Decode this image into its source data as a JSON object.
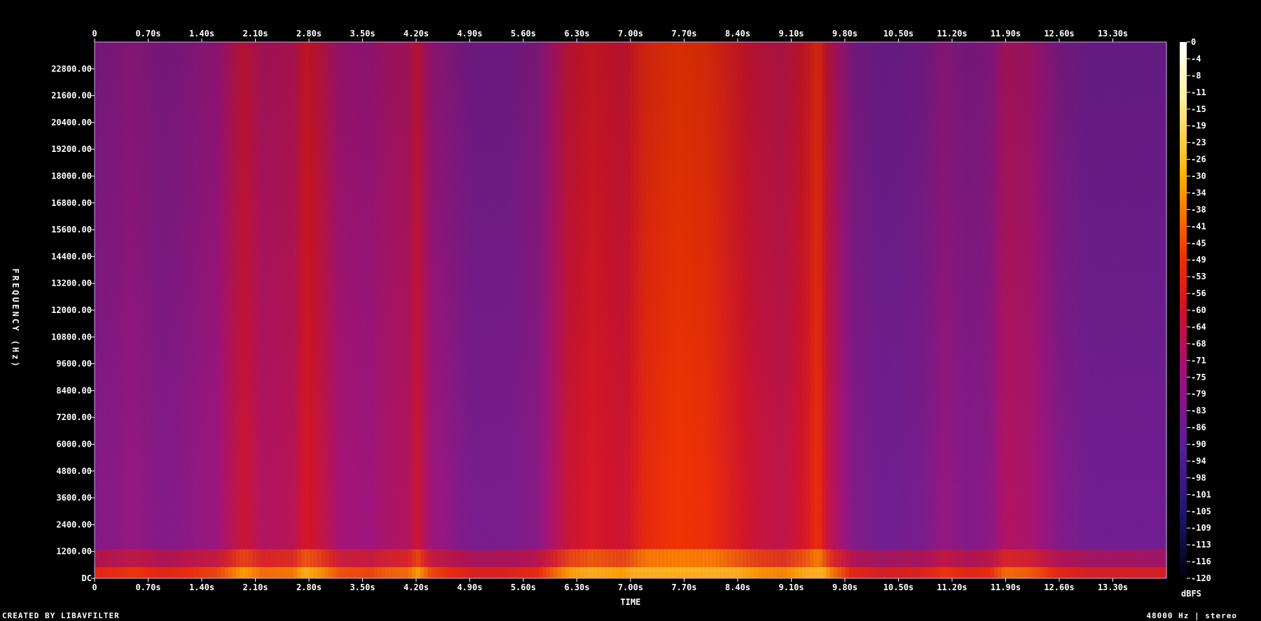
{
  "chart_data": {
    "type": "heatmap",
    "subtype": "spectrogram",
    "xlabel": "TIME",
    "ylabel": "FREQUENCY (Hz)",
    "x_ticks": [
      "0",
      "0.70s",
      "1.40s",
      "2.10s",
      "2.80s",
      "3.50s",
      "4.20s",
      "4.90s",
      "5.60s",
      "6.30s",
      "7.00s",
      "7.70s",
      "8.40s",
      "9.10s",
      "9.80s",
      "10.50s",
      "11.20s",
      "11.90s",
      "12.60s",
      "13.30s"
    ],
    "x_range_seconds": [
      0,
      14.0
    ],
    "y_ticks": [
      "DC",
      "1200.00",
      "2400.00",
      "3600.00",
      "4800.00",
      "6000.00",
      "7200.00",
      "8400.00",
      "9600.00",
      "10800.00",
      "12000.00",
      "13200.00",
      "14400.00",
      "15600.00",
      "16800.00",
      "18000.00",
      "19200.00",
      "20400.00",
      "21600.00",
      "22800.00"
    ],
    "y_range_hz": [
      0,
      24000
    ],
    "colorbar": {
      "unit": "dBFS",
      "ticks": [
        "0",
        "-4",
        "-8",
        "-11",
        "-15",
        "-19",
        "-23",
        "-26",
        "-30",
        "-34",
        "-38",
        "-41",
        "-45",
        "-49",
        "-53",
        "-56",
        "-60",
        "-64",
        "-68",
        "-71",
        "-75",
        "-79",
        "-83",
        "-86",
        "-90",
        "-94",
        "-98",
        "-101",
        "-105",
        "-109",
        "-113",
        "-116",
        "-120"
      ],
      "range_db": [
        -120,
        0
      ]
    },
    "energy_profile": [
      {
        "t": 0.0,
        "db": -82
      },
      {
        "t": 0.3,
        "db": -80
      },
      {
        "t": 0.5,
        "db": -78
      },
      {
        "t": 0.9,
        "db": -82
      },
      {
        "t": 1.2,
        "db": -80
      },
      {
        "t": 1.6,
        "db": -76
      },
      {
        "t": 1.8,
        "db": -68
      },
      {
        "t": 1.95,
        "db": -62
      },
      {
        "t": 2.2,
        "db": -70
      },
      {
        "t": 2.6,
        "db": -68
      },
      {
        "t": 2.75,
        "db": -58
      },
      {
        "t": 2.95,
        "db": -64
      },
      {
        "t": 3.2,
        "db": -74
      },
      {
        "t": 3.6,
        "db": -76
      },
      {
        "t": 3.8,
        "db": -72
      },
      {
        "t": 4.1,
        "db": -70
      },
      {
        "t": 4.22,
        "db": -62
      },
      {
        "t": 4.4,
        "db": -76
      },
      {
        "t": 4.9,
        "db": -84
      },
      {
        "t": 5.4,
        "db": -84
      },
      {
        "t": 5.8,
        "db": -80
      },
      {
        "t": 6.2,
        "db": -62
      },
      {
        "t": 6.5,
        "db": -58
      },
      {
        "t": 6.9,
        "db": -62
      },
      {
        "t": 7.2,
        "db": -52
      },
      {
        "t": 7.6,
        "db": -48
      },
      {
        "t": 8.0,
        "db": -50
      },
      {
        "t": 8.4,
        "db": -58
      },
      {
        "t": 8.7,
        "db": -64
      },
      {
        "t": 9.0,
        "db": -66
      },
      {
        "t": 9.3,
        "db": -58
      },
      {
        "t": 9.45,
        "db": -50
      },
      {
        "t": 9.6,
        "db": -66
      },
      {
        "t": 9.9,
        "db": -82
      },
      {
        "t": 10.3,
        "db": -86
      },
      {
        "t": 10.8,
        "db": -84
      },
      {
        "t": 11.1,
        "db": -78
      },
      {
        "t": 11.4,
        "db": -82
      },
      {
        "t": 11.7,
        "db": -80
      },
      {
        "t": 11.9,
        "db": -70
      },
      {
        "t": 12.2,
        "db": -72
      },
      {
        "t": 12.6,
        "db": -82
      },
      {
        "t": 13.0,
        "db": -86
      },
      {
        "t": 13.5,
        "db": -86
      },
      {
        "t": 14.0,
        "db": -86
      }
    ]
  },
  "footer": {
    "left": "CREATED BY LIBAVFILTER",
    "right": "48000 Hz | stereo"
  }
}
